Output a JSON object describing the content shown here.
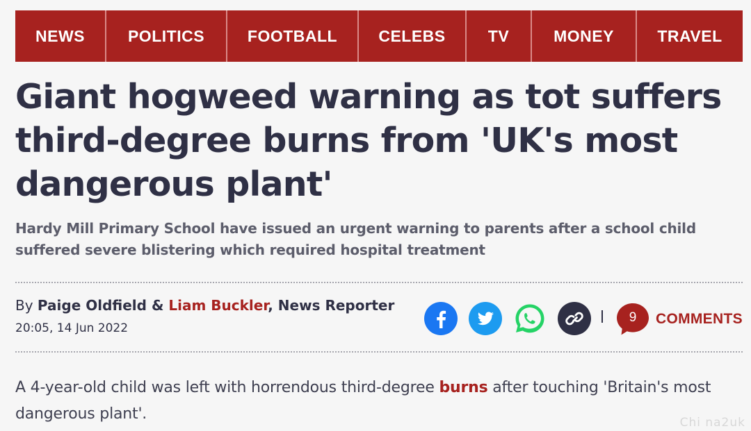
{
  "nav": {
    "items": [
      "NEWS",
      "POLITICS",
      "FOOTBALL",
      "CELEBS",
      "TV",
      "MONEY",
      "TRAVEL"
    ]
  },
  "article": {
    "headline": "Giant hogweed warning as tot suffers third-degree burns from 'UK's most dangerous plant'",
    "standfirst": "Hardy Mill Primary School have issued an urgent warning to parents after a school child suffered severe blistering which required hospital treatment",
    "byline": {
      "prefix": "By ",
      "author1": "Paige Oldfield",
      "conj": " & ",
      "author2": "Liam Buckler",
      "role": ", News Reporter"
    },
    "timestamp": "20:05, 14 Jun 2022",
    "body": {
      "before": "A 4-year-old child was left with horrendous third-degree ",
      "keyword": "burns",
      "after": " after touching 'Britain's most dangerous plant'."
    }
  },
  "share": {
    "icons": [
      "facebook-icon",
      "twitter-icon",
      "whatsapp-icon",
      "link-icon"
    ]
  },
  "comments": {
    "count": "9",
    "label": "COMMENTS"
  },
  "watermark": "Chi na2uk",
  "colors": {
    "brand": "#a7221f",
    "text": "#2f3045",
    "facebook": "#1a77f2",
    "twitter": "#1d9bf0",
    "whatsapp": "#25d366"
  }
}
